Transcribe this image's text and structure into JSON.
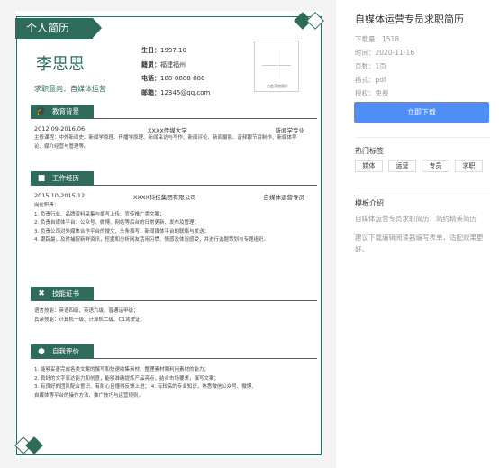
{
  "resume": {
    "title": "个人简历",
    "name": "李思思",
    "intent": "求职意向：自媒体运营",
    "info": {
      "birth_label": "生日：",
      "birth": "1997.10",
      "origin_label": "籍贯：",
      "origin": "福建福州",
      "phone_label": "电话：",
      "phone": "188-8888-888",
      "email_label": "邮箱：",
      "email": "12345@qq.com"
    },
    "photo_caption": "点此添加照片",
    "education": {
      "heading": "教育背景",
      "dates": "2012.09-2016.06",
      "school": "XXXX传媒大学",
      "major": "新闻学专业",
      "courses": "主修课程：中外新闻史、新闻学原理、传播学原理、新闻采访与写作、新闻评论、新闻摄影、音频跟节目制作、新媒体导论、媒介经营与管理等。"
    },
    "work": {
      "heading": "工作经历",
      "dates": "2015.10-2015.12",
      "company": "XXXX科技集团有限公司",
      "role": "自媒体运营专员",
      "duties_title": "岗位职责：",
      "duties": [
        "1. 负责行业、品牌资料采集与撰写上传、宣传推广类文案；",
        "2. 负责自媒体平台：公众号、微博、网站等后台的日常更新、发布及管理；",
        "3. 负责公司对外媒体合作平台的搜文、头条撰写，新闻媒体平台的联络与发送；",
        "4. 跟踪最，及时捕捉新鲜资讯，挖掘和分析网友活用习惯、情感及体验感受，并进行选题策划与专题组织。"
      ]
    },
    "skills": {
      "heading": "技能证书",
      "language": "语言技能：英语四级、英语六级、普通话甲级；",
      "other": "其余技能：计算机一级、计算机二级、C1驾驶证；"
    },
    "evaluation": {
      "heading": "自我评价",
      "items": [
        "1. 能够妥善完成各类文案的撰写和快速收集素材、整理素材和利用素材的能力；",
        "2. 良好的文字表达能力和创意，能够准确提炼产品亮点，结合市场要求，撰写文案；",
        "3. 有良好的团队配合意识、有耐心且懂得反馈上进； 4. 有较高的专业知识，熟悉微信公众号、微博、",
        "自媒体等平台的操作方法、推广技巧与运营规则。"
      ]
    }
  },
  "panel": {
    "title": "自媒体运营专员求职简历",
    "downloads": "下载量：1518",
    "time": "时间：2020-11-16",
    "pages": "页数：1页",
    "format": "格式：pdf",
    "license": "授权：免费",
    "download_button": "立即下载",
    "tags_heading": "热门标签",
    "tags": [
      "媒体",
      "运营",
      "专员",
      "求职"
    ],
    "intro_heading": "模板介绍",
    "intro_text": "自媒体运营专员求职简历，简约精美简历",
    "tip": "建议下载编辑阅读器编写表单，适配效果更好。",
    "accent_color": "#4f8ef7"
  },
  "theme": {
    "resume_green": "#2f6b5b"
  }
}
